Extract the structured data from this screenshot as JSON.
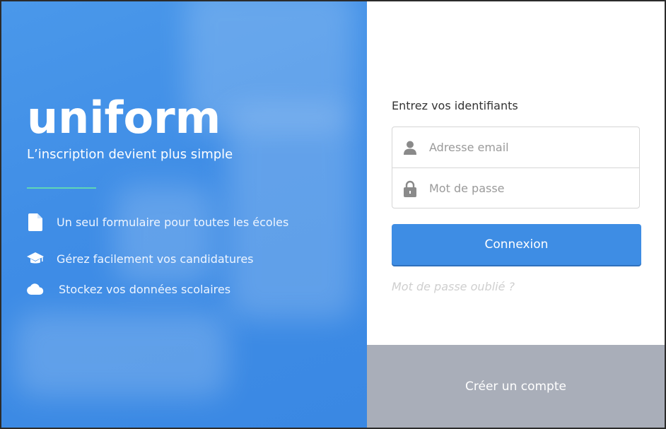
{
  "hero": {
    "brand": "uniform",
    "tagline": "L’inscription devient plus simple",
    "features": [
      {
        "icon": "document-icon",
        "label": "Un seul formulaire pour toutes les écoles"
      },
      {
        "icon": "graduation-cap-icon",
        "label": "Gérez facilement vos candidatures"
      },
      {
        "icon": "cloud-icon",
        "label": "Stockez vos données scolaires"
      }
    ]
  },
  "login": {
    "prompt": "Entrez vos identifiants",
    "email_placeholder": "Adresse email",
    "password_placeholder": "Mot de passe",
    "submit_label": "Connexion",
    "forgot_label": "Mot de passe oublié ?"
  },
  "footer": {
    "create_account_label": "Créer un compte"
  },
  "colors": {
    "hero_blue": "#4393e8",
    "button_blue": "#3e8de4",
    "accent_green": "#5fd6b6",
    "footer_gray": "#a9aeb9"
  }
}
